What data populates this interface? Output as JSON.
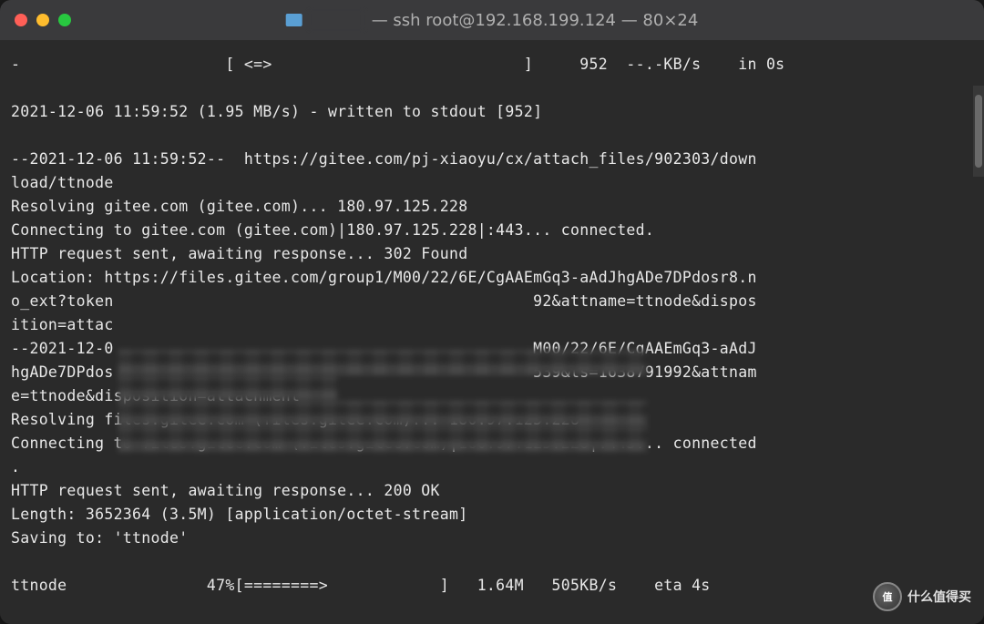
{
  "window": {
    "title_suffix": "— ssh root@192.168.199.124 — 80×24"
  },
  "terminal": {
    "line01": "-                      [ <=>                           ]     952  --.-KB/s    in 0s",
    "line02": "",
    "line03": "2021-12-06 11:59:52 (1.95 MB/s) - written to stdout [952]",
    "line04": "",
    "line05": "--2021-12-06 11:59:52--  https://gitee.com/pj-xiaoyu/cx/attach_files/902303/down",
    "line06": "load/ttnode",
    "line07": "Resolving gitee.com (gitee.com)... 180.97.125.228",
    "line08": "Connecting to gitee.com (gitee.com)|180.97.125.228|:443... connected.",
    "line09": "HTTP request sent, awaiting response... 302 Found",
    "line10": "Location: https://files.gitee.com/group1/M00/22/6E/CgAAEmGq3-aAdJhgADe7DPdosr8.n",
    "line11": "o_ext?token                                             92&attname=ttnode&dispos",
    "line12": "ition=attac",
    "line13": "--2021-12-0                                             M00/22/6E/CgAAEmGq3-aAdJ",
    "line14": "hgADe7DPdos                                             539&ts=1638791992&attnam",
    "line15": "e=ttnode&disposition=attachment",
    "line16": "Resolving files.gitee.com (files.gitee.com)... 180.97.125.228",
    "line17": "Connecting to files.gitee.com (files.gitee.com)|180.97.125.228|:443... connected",
    "line18": ".",
    "line19": "HTTP request sent, awaiting response... 200 OK",
    "line20": "Length: 3652364 (3.5M) [application/octet-stream]",
    "line21": "Saving to: 'ttnode'",
    "line22": "",
    "line23": "ttnode               47%[========>            ]   1.64M   505KB/s    eta 4s"
  },
  "watermark": {
    "text": "什么值得买",
    "badge": "值"
  }
}
